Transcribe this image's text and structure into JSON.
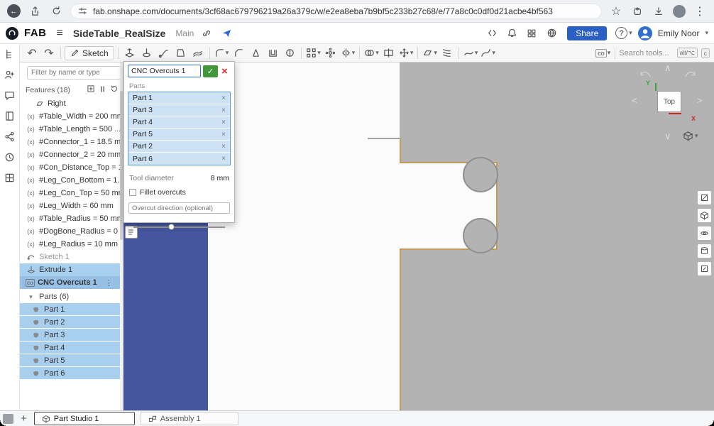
{
  "browser": {
    "url": "fab.onshape.com/documents/3cf68ac679796219a26a379c/w/e2ea8eba7b9bf5c233b27c68/e/77a8c0c0df0d21acbe4bf563"
  },
  "header": {
    "brand": "FAB",
    "title": "SideTable_RealSize",
    "workspace": "Main",
    "share": "Share",
    "user": "Emily Noor"
  },
  "toolbar": {
    "sketch": "Sketch",
    "custom_feature": "co",
    "search": "Search tools...",
    "key1": "alt/⌥",
    "key2": "c"
  },
  "icons": {
    "menu": "≡",
    "undo": "↶",
    "redo": "↷",
    "star": "☆",
    "overflow": "⋮",
    "plus": "+",
    "confirm": "✓",
    "cancel": "×",
    "remove": "×",
    "caret": "▾",
    "variable": "(x)",
    "drag": "⋮",
    "co": "co",
    "back": "←",
    "arrow_up": "∧",
    "arrow_down": "∨",
    "arrow_left": "<",
    "arrow_right": ">"
  },
  "feature_panel": {
    "filter_placeholder": "Filter by name or type",
    "header": "Features (18)",
    "items": [
      {
        "label": "Right"
      },
      {
        "label": "#Table_Width = 200 mm"
      },
      {
        "label": "#Table_Length = 500 ..."
      },
      {
        "label": "#Connector_1 = 18.5 m..."
      },
      {
        "label": "#Connector_2 = 20 mm"
      },
      {
        "label": "#Con_Distance_Top = 1..."
      },
      {
        "label": "#Leg_Con_Bottom = 1..."
      },
      {
        "label": "#Leg_Con_Top = 50 mm"
      },
      {
        "label": "#Leg_Width = 60 mm"
      },
      {
        "label": "#Table_Radius = 50 mm"
      },
      {
        "label": "#DogBone_Radius = 0 ..."
      },
      {
        "label": "#Leg_Radius = 10 mm"
      },
      {
        "label": "Sketch 1"
      },
      {
        "label": "Extrude 1"
      },
      {
        "label": "CNC Overcuts 1"
      }
    ],
    "parts_header": "Parts (6)",
    "parts": [
      {
        "label": "Part 1"
      },
      {
        "label": "Part 2"
      },
      {
        "label": "Part 3"
      },
      {
        "label": "Part 4"
      },
      {
        "label": "Part 5"
      },
      {
        "label": "Part 6"
      }
    ]
  },
  "dialog": {
    "title": "CNC Overcuts 1",
    "parts_label": "Parts",
    "parts": [
      {
        "label": "Part 1"
      },
      {
        "label": "Part 3"
      },
      {
        "label": "Part 4"
      },
      {
        "label": "Part 5"
      },
      {
        "label": "Part 2"
      },
      {
        "label": "Part 6"
      }
    ],
    "tool_diameter_label": "Tool diameter",
    "tool_diameter_value": "8 mm",
    "fillet_label": "Fillet overcuts",
    "direction_placeholder": "Overcut direction (optional)"
  },
  "viewport": {
    "view_cube": "Top",
    "axis_x": "X",
    "axis_y": "Y"
  },
  "tabs": [
    {
      "label": "Part Studio 1"
    },
    {
      "label": "Assembly 1"
    }
  ]
}
